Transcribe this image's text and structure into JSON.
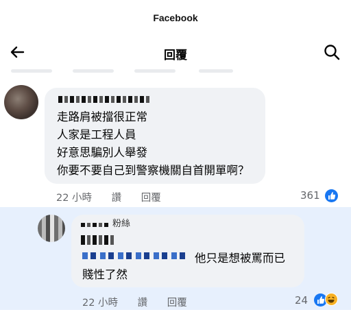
{
  "app": {
    "title": "Facebook"
  },
  "nav": {
    "title": "回覆",
    "back_icon": "arrow-left-icon",
    "search_icon": "search-icon"
  },
  "comment": {
    "lines": [
      "走路肩被擋很正常",
      "人家是工程人員",
      "好意思騙別人舉發",
      "你要不要自己到警察機關自首開單啊？"
    ],
    "time": "22 小時",
    "like_label": "讚",
    "reply_label": "回覆",
    "reaction_count": "361"
  },
  "reply": {
    "name_suffix": "粉絲",
    "text_line1": "他只是想被罵而已",
    "text_line2": "賤性了然",
    "time": "22 小時",
    "like_label": "讚",
    "reply_label": "回覆",
    "reaction_count": "24"
  },
  "colors": {
    "like_blue": "#1877f2",
    "highlight": "#e7f0fd",
    "bubble": "#f0f2f5",
    "meta_gray": "#65676b"
  }
}
